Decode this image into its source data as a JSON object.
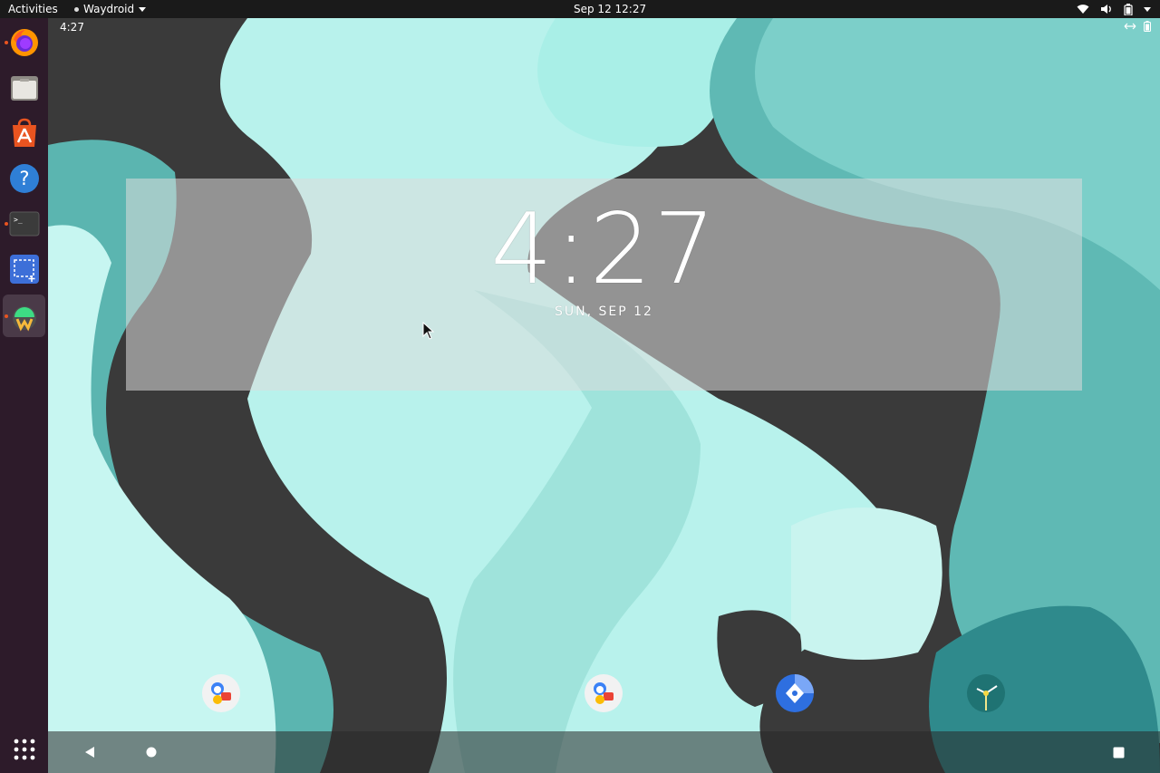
{
  "topbar": {
    "activities": "Activities",
    "app_name": "Waydroid",
    "datetime": "Sep 12  12:27",
    "system_icons": [
      "wifi-icon",
      "volume-icon",
      "battery-icon",
      "system-menu-caret"
    ]
  },
  "dock": {
    "items": [
      {
        "name": "Firefox",
        "icon": "firefox-icon",
        "running": true
      },
      {
        "name": "Files",
        "icon": "files-icon",
        "running": false
      },
      {
        "name": "Ubuntu Software",
        "icon": "software-icon",
        "running": false
      },
      {
        "name": "Help",
        "icon": "help-icon",
        "running": false
      },
      {
        "name": "Terminal",
        "icon": "terminal-icon",
        "running": true
      },
      {
        "name": "Screenshot",
        "icon": "screenshot-icon",
        "running": false
      },
      {
        "name": "Waydroid",
        "icon": "waydroid-icon",
        "running": true,
        "active": true
      }
    ],
    "show_apps_icon": "app-grid-icon"
  },
  "android": {
    "status_time": "4:27",
    "status_icons": [
      "data-sync-icon",
      "battery-icon"
    ],
    "clock_widget": {
      "time": "4:27",
      "date": "SUN, SEP 12"
    },
    "hotseat": [
      {
        "name": "Messaging",
        "icon": "messaging-icon"
      },
      {
        "name": "Messaging",
        "icon": "messaging-icon"
      },
      {
        "name": "Navigation",
        "icon": "navigation-icon"
      },
      {
        "name": "Clock",
        "icon": "clock-icon"
      }
    ],
    "navbar": [
      "back-icon",
      "home-icon",
      "recents-icon"
    ]
  },
  "colors": {
    "topbar_bg": "#1a1a1a",
    "dock_bg": "#2d1b2a",
    "running_indicator": "#e95420",
    "wallpaper_teal": "#9ee6dd",
    "wallpaper_dark": "#3a3a3a"
  }
}
